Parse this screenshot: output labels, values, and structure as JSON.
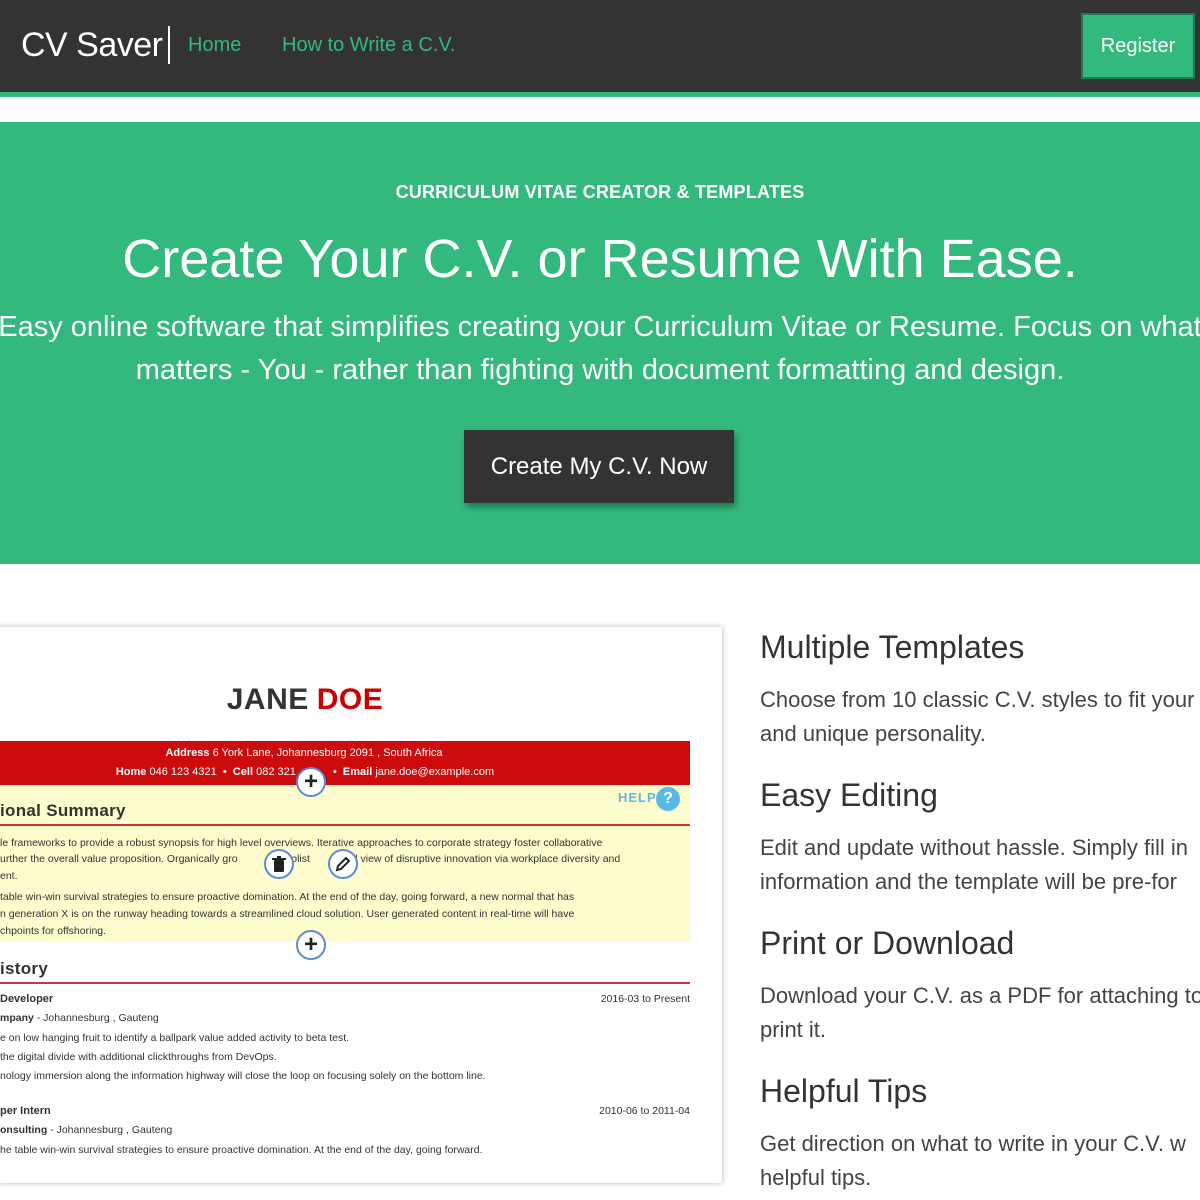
{
  "navbar": {
    "brand": "CV Saver",
    "links": [
      "Home",
      "How to Write a C.V."
    ],
    "register_label": "Register"
  },
  "hero": {
    "kicker": "CURRICULUM VITAE CREATOR & TEMPLATES",
    "title": "Create Your C.V. or Resume With Ease.",
    "subtitle_line1": "Easy online software that simplifies creating your Curriculum Vitae or Resume. Focus on what",
    "subtitle_line2": "matters - You - rather than fighting with document formatting and design.",
    "cta_label": "Create My C.V. Now"
  },
  "cv_preview": {
    "first_name": "JANE",
    "last_name": "DOE",
    "address_label": "Address",
    "address": "6 York Lane, Johannesburg 2091 , South Africa",
    "home_label": "Home",
    "home": "046 123 4321",
    "cell_label": "Cell",
    "cell": "082 321",
    "email_label": "Email",
    "email": "jane.doe@example.com",
    "help_label": "HELP",
    "help_icon_char": "?",
    "summary_heading": "ional Summary",
    "summary_lines": [
      "le frameworks to provide a robust synopsis for high level overviews. Iterative approaches to corporate strategy foster collaborative",
      "urther the overall value proposition. Organically gro",
      "holist",
      "d view of disruptive innovation via workplace diversity and",
      "ent.",
      "table win-win survival strategies to ensure proactive domination. At the end of the day, going forward, a new normal that has",
      "n generation X is on the runway heading towards a streamlined cloud solution. User generated content in real-time will have",
      "chpoints for offshoring."
    ],
    "history_heading": "istory",
    "jobs": [
      {
        "title": " Developer",
        "company": "mpany",
        "location": " - Johannesburg , Gauteng",
        "dates": "2016-03 to Present",
        "lines": [
          "e on low hanging fruit to identify a ballpark value added activity to beta test.",
          "the digital divide with additional clickthroughs from DevOps.",
          "nology immersion along the information highway will close the loop on focusing solely on the bottom line."
        ]
      },
      {
        "title": "per Intern",
        "company": "onsulting",
        "location": " - Johannesburg , Gauteng",
        "dates": "2010-06 to 2011-04",
        "lines": [
          "he table win-win survival strategies to ensure proactive domination. At the end of the day, going forward."
        ]
      }
    ]
  },
  "features": [
    {
      "title": "Multiple Templates",
      "line1": "Choose from 10 classic C.V. styles to fit your",
      "line2": "and unique personality."
    },
    {
      "title": "Easy Editing",
      "line1": "Edit and update without hassle. Simply fill in",
      "line2": "information and the template will be pre-for"
    },
    {
      "title": "Print or Download",
      "line1": "Download your C.V. as a PDF for attaching to",
      "line2": "print it."
    },
    {
      "title": "Helpful Tips",
      "line1": "Get direction on what to write in your C.V. w",
      "line2": "helpful tips."
    }
  ],
  "colors": {
    "navbar_bg": "#333333",
    "accent_green": "#33b97d",
    "cv_red": "#cc0c0c",
    "summary_bg": "#fcfccc",
    "help_blue": "#5bb9e6"
  },
  "icons": {
    "add": "plus-icon",
    "delete": "trash-icon",
    "edit": "pencil-icon",
    "help": "question-icon"
  }
}
